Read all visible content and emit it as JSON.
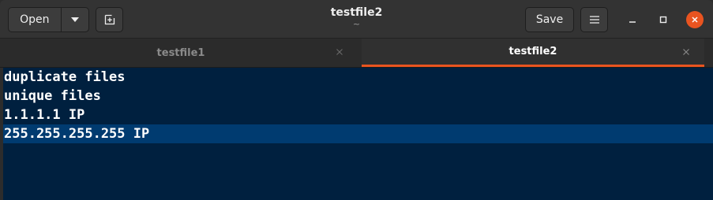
{
  "header": {
    "open_label": "Open",
    "save_label": "Save",
    "title": "testfile2",
    "subtitle": "~"
  },
  "tabs": [
    {
      "label": "testfile1",
      "active": false
    },
    {
      "label": "testfile2",
      "active": true
    }
  ],
  "editor": {
    "lines": [
      "duplicate files",
      "unique files",
      "1.1.1.1 IP",
      "255.255.255.255 IP"
    ],
    "current_line": 4
  },
  "colors": {
    "accent": "#e95420",
    "editor_bg": "#00203f",
    "current_line_bg": "#003b70",
    "headerbar_bg": "#333333"
  },
  "icons": {
    "open_dropdown": "chevron-down-icon",
    "new_tab": "new-tab-icon",
    "menu": "hamburger-menu-icon",
    "minimize": "minimize-icon",
    "maximize": "maximize-icon",
    "close": "close-icon"
  }
}
